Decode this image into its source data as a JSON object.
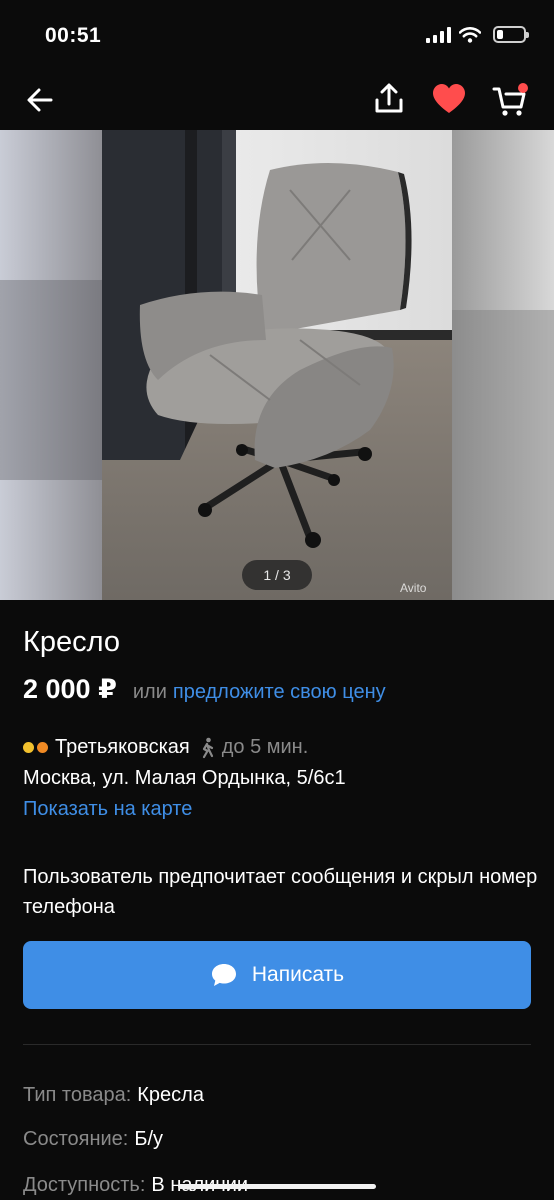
{
  "status_bar": {
    "time": "00:51"
  },
  "gallery": {
    "counter": "1 / 3",
    "watermark": "Avito"
  },
  "listing": {
    "title": "Кресло",
    "price": "2 000 ₽",
    "or_label": "или",
    "offer_link": "предложите свою цену"
  },
  "location": {
    "metro_line_colors": [
      "#f2c12e",
      "#f08a24"
    ],
    "metro_station": "Третьяковская",
    "walk_time": "до 5 мин.",
    "address": "Москва, ул. Малая Ордынка, 5/6с1",
    "map_link": "Показать на карте"
  },
  "contact_note": "Пользователь предпочитает сообщения и скрыл номер телефона",
  "write_button": {
    "label": "Написать",
    "icon": "chat-bubble-icon"
  },
  "params": [
    {
      "key": "Тип товара:",
      "value": "Кресла"
    },
    {
      "key": "Состояние:",
      "value": "Б/у"
    },
    {
      "key": "Доступность:",
      "value": "В наличии"
    }
  ],
  "colors": {
    "accent": "#3f8ee6",
    "favorite": "#ff4d4d",
    "background": "#0b0b0b"
  }
}
